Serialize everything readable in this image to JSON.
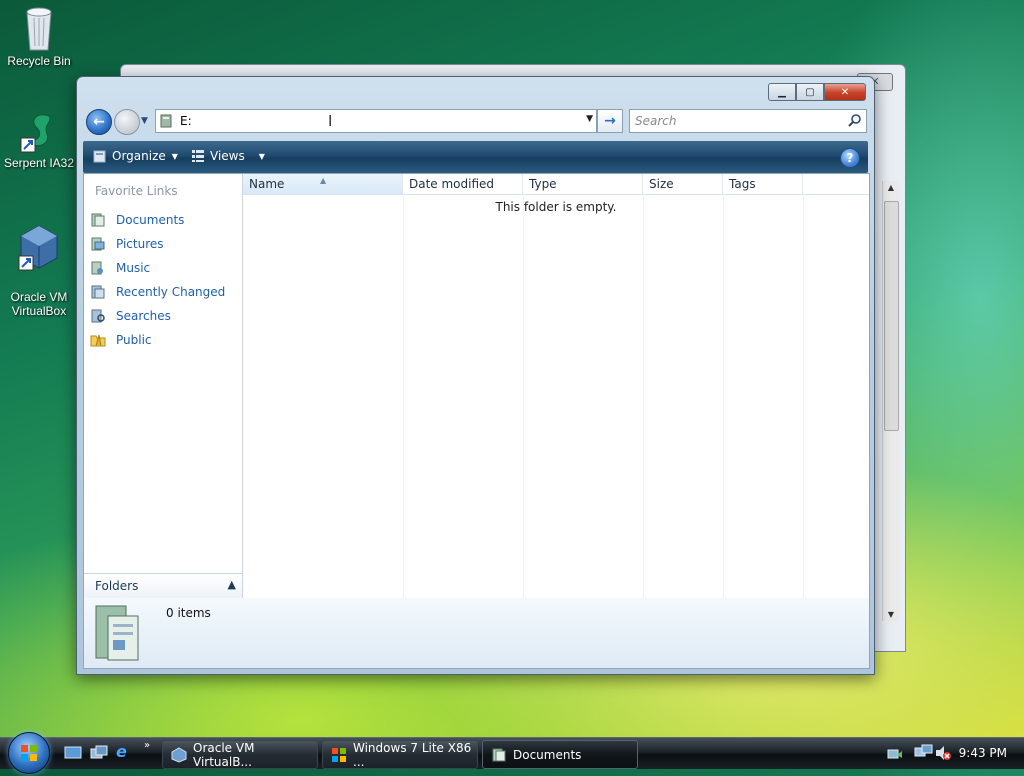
{
  "desktop": {
    "icons": [
      {
        "label": "Recycle Bin"
      },
      {
        "label": "Serpent IA32"
      },
      {
        "label": "Oracle VM\nVirtualBox"
      }
    ]
  },
  "window": {
    "title": "Documents",
    "address": {
      "value": "E:"
    },
    "search": {
      "placeholder": "Search"
    },
    "toolbar": {
      "organize": "Organize",
      "views": "Views"
    },
    "nav_pane": {
      "heading": "Favorite Links",
      "items": [
        {
          "label": "Documents",
          "icon": "documents-icon"
        },
        {
          "label": "Pictures",
          "icon": "pictures-icon"
        },
        {
          "label": "Music",
          "icon": "music-icon"
        },
        {
          "label": "Recently Changed",
          "icon": "recently-changed-icon"
        },
        {
          "label": "Searches",
          "icon": "searches-icon"
        },
        {
          "label": "Public",
          "icon": "public-folder-icon"
        }
      ],
      "folders_label": "Folders"
    },
    "columns": [
      "Name",
      "Date modified",
      "Type",
      "Size",
      "Tags"
    ],
    "empty_message": "This folder is empty.",
    "details": {
      "item_count": "0 items"
    }
  },
  "taskbar": {
    "buttons": [
      {
        "label": "Oracle VM VirtualB..."
      },
      {
        "label": "Windows 7 Lite X86 ..."
      },
      {
        "label": "Documents"
      }
    ],
    "clock": "9:43 PM"
  }
}
